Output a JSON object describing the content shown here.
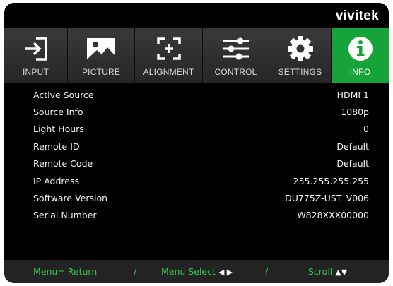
{
  "brand": {
    "logo_text": "vivitek"
  },
  "tabs": [
    {
      "label": "INPUT",
      "icon": "input-icon",
      "active": false
    },
    {
      "label": "PICTURE",
      "icon": "picture-icon",
      "active": false
    },
    {
      "label": "ALIGNMENT",
      "icon": "alignment-icon",
      "active": false
    },
    {
      "label": "CONTROL",
      "icon": "control-sliders-icon",
      "active": false
    },
    {
      "label": "SETTINGS",
      "icon": "gear-icon",
      "active": false
    },
    {
      "label": "INFO",
      "icon": "info-icon",
      "active": true
    }
  ],
  "info_rows": [
    {
      "label": "Active Source",
      "value": "HDMI 1"
    },
    {
      "label": "Source Info",
      "value": "1080p"
    },
    {
      "label": "Light Hours",
      "value": "0"
    },
    {
      "label": "Remote ID",
      "value": "Default"
    },
    {
      "label": "Remote Code",
      "value": "Default"
    },
    {
      "label": "IP Address",
      "value": "255.255.255.255"
    },
    {
      "label": "Software Version",
      "value": "DU775Z-UST_V006"
    },
    {
      "label": "Serial Number",
      "value": "W828XXX00000"
    }
  ],
  "footer": {
    "menu_return": "Menu= Return",
    "sep1": "/",
    "menu_select": "Menu Select",
    "select_arrows": "◀ ▶",
    "sep2": "/",
    "scroll": "Scroll",
    "scroll_arrows": "▲▼"
  },
  "colors": {
    "active_tab": "#16a33a",
    "footer_text": "#35c24f",
    "background": "#000000"
  }
}
